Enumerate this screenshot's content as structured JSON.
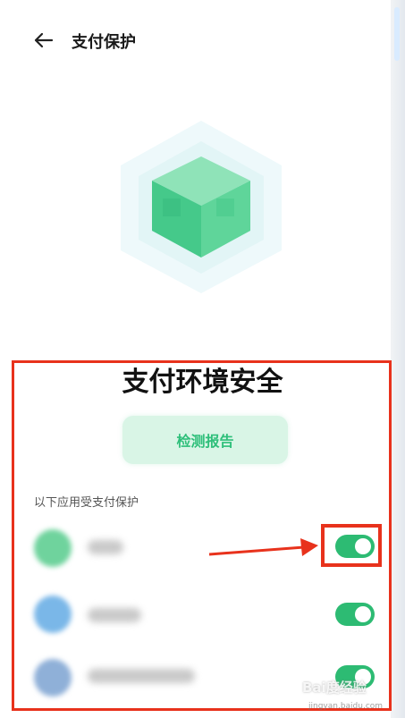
{
  "header": {
    "title": "支付保护",
    "back_icon": "arrow-left-icon"
  },
  "hero": {
    "icon": "green-cube-icon",
    "color": "#3ccf8e"
  },
  "status": {
    "title": "支付环境安全",
    "report_button": "检测报告"
  },
  "apps": {
    "section_label": "以下应用受支付保护",
    "items": [
      {
        "name_hidden": true,
        "protected": true,
        "icon_color": "#6fd39d"
      },
      {
        "name_hidden": true,
        "protected": true,
        "icon_color": "#7ab7e8"
      },
      {
        "name_hidden": true,
        "protected": true,
        "icon_color": "#8fb0d8"
      }
    ]
  },
  "annotation": {
    "highlight_color": "#e8321c"
  },
  "watermark": {
    "brand": "Bai度经验",
    "url": "jingyan.baidu.com"
  }
}
